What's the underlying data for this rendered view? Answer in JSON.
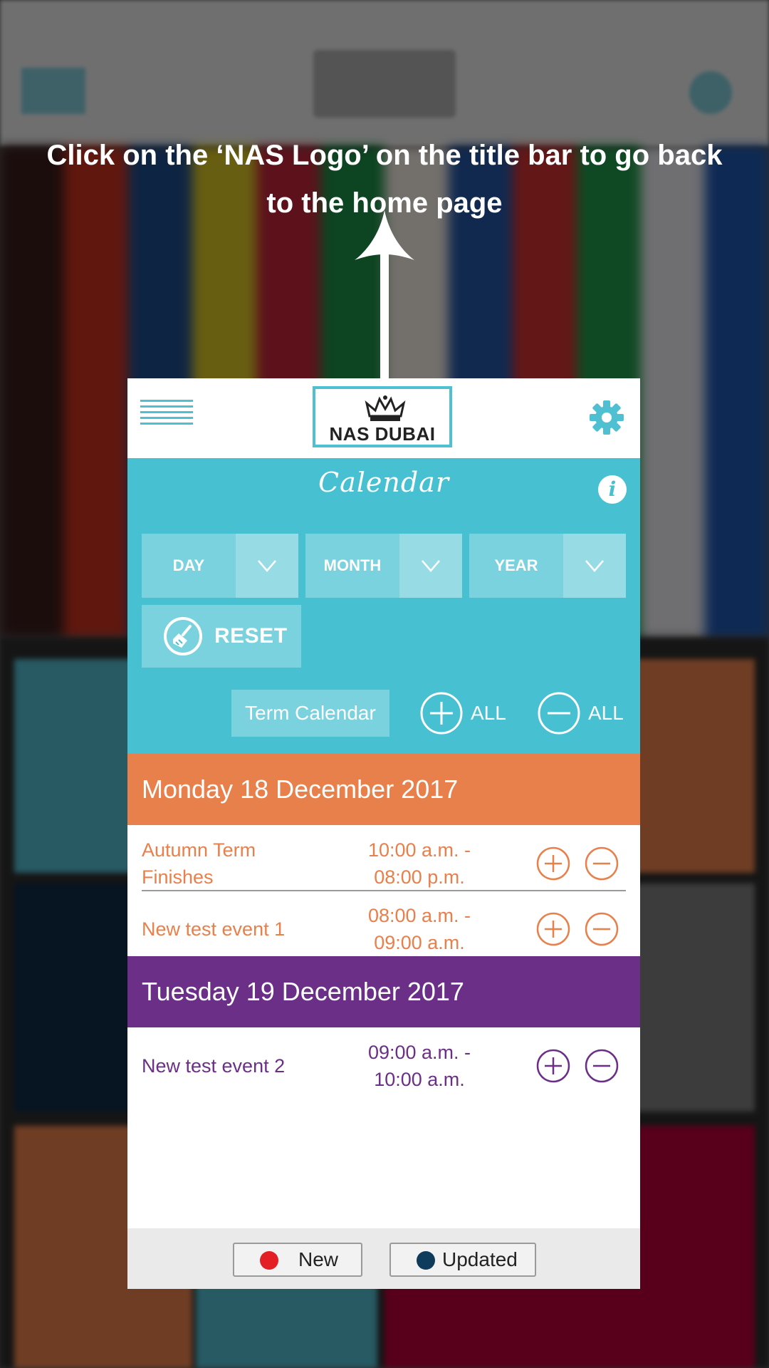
{
  "instruction": "Click on the ‘NAS Logo’ on the title bar to go back to the home page",
  "header": {
    "logo_text": "NAS DUBAI",
    "menu_icon": "hamburger-menu-icon",
    "settings_icon": "gear-icon",
    "brand_color": "#47c1d2"
  },
  "calendar": {
    "title": "Calendar",
    "info_label": "i",
    "selectors": [
      {
        "label": "DAY"
      },
      {
        "label": "MONTH"
      },
      {
        "label": "YEAR"
      }
    ],
    "reset_label": "RESET",
    "term_calendar_label": "Term Calendar",
    "expand_all_label": "ALL",
    "collapse_all_label": "ALL"
  },
  "days": [
    {
      "header": "Monday 18 December 2017",
      "color": "#e8804c",
      "events": [
        {
          "name": "Autumn Term Finishes",
          "time": "10:00 a.m. - 08:00 p.m."
        },
        {
          "name": "New test event 1",
          "time": "08:00 a.m. - 09:00 a.m."
        }
      ]
    },
    {
      "header": "Tuesday 19 December 2017",
      "color": "#6b2f88",
      "events": [
        {
          "name": "New test event 2",
          "time": "09:00 a.m. - 10:00 a.m."
        }
      ]
    }
  ],
  "legend": {
    "new_label": "New",
    "new_color": "#e31e24",
    "updated_label": "Updated",
    "updated_color": "#0e3a5c"
  }
}
